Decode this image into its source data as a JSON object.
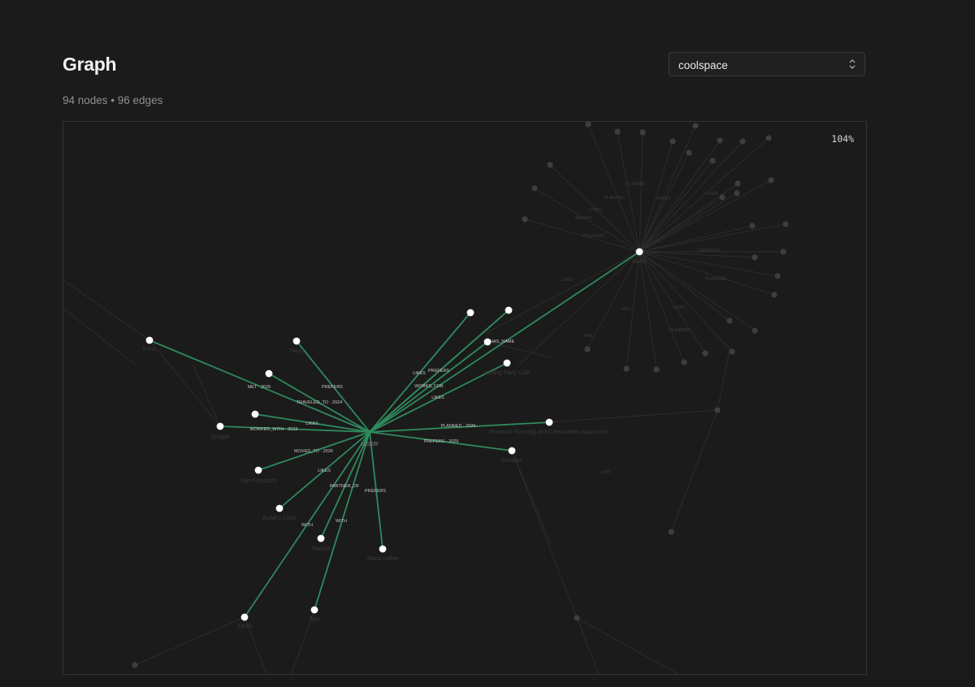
{
  "header": {
    "title": "Graph",
    "stats": "94 nodes • 96 edges"
  },
  "space_select": {
    "value": "coolspace"
  },
  "canvas": {
    "zoom": "104%"
  },
  "graph": {
    "center_label": "USER",
    "hub_label": "Alpha",
    "edge_labels": [
      "PREFERS",
      "MET · 2026",
      "TRAVELED_TO · 2024",
      "LIKES",
      "WORKED_WITH · 2023",
      "MOVED_TO · 2026",
      "LIKES",
      "PARTNER_OF",
      "WITH",
      "WITH",
      "PREFERS",
      "LIKES",
      "PREFERS",
      "WORKS_FOR",
      "LIKES",
      "HAS_NAME",
      "PLANNED · 2026",
      "PREFERS · 2026"
    ],
    "node_labels": [
      "Paris",
      "Tokyo",
      "Google",
      "San Francisco",
      "Rubik's Cube",
      "Rachel",
      "Black coffee",
      "Sarah",
      "Tom",
      "Cutting Party Club",
      "Financial Planning and Consultation Application",
      "Creative"
    ]
  }
}
